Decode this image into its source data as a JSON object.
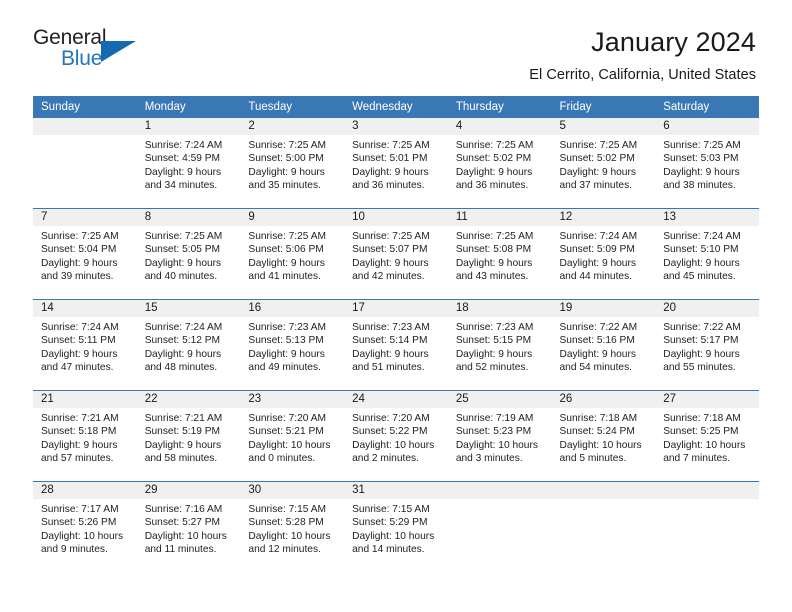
{
  "logo": {
    "text_primary": "General",
    "text_secondary": "Blue",
    "icon": "triangle-logo-mark",
    "color_primary": "#231f20",
    "color_secondary": "#2176bd"
  },
  "header": {
    "title": "January 2024",
    "subtitle": "El Cerrito, California, United States"
  },
  "theme": {
    "header_blue": "#3a77b5",
    "daynum_bg": "#f0f0f0",
    "text": "#1a1a1a"
  },
  "calendar": {
    "weekday_headers": [
      "Sunday",
      "Monday",
      "Tuesday",
      "Wednesday",
      "Thursday",
      "Friday",
      "Saturday"
    ],
    "weeks": [
      [
        {
          "day": "",
          "blank": true,
          "sunrise": "",
          "sunset": "",
          "daylight_1": "",
          "daylight_2": ""
        },
        {
          "day": "1",
          "sunrise": "Sunrise: 7:24 AM",
          "sunset": "Sunset: 4:59 PM",
          "daylight_1": "Daylight: 9 hours",
          "daylight_2": "and 34 minutes."
        },
        {
          "day": "2",
          "sunrise": "Sunrise: 7:25 AM",
          "sunset": "Sunset: 5:00 PM",
          "daylight_1": "Daylight: 9 hours",
          "daylight_2": "and 35 minutes."
        },
        {
          "day": "3",
          "sunrise": "Sunrise: 7:25 AM",
          "sunset": "Sunset: 5:01 PM",
          "daylight_1": "Daylight: 9 hours",
          "daylight_2": "and 36 minutes."
        },
        {
          "day": "4",
          "sunrise": "Sunrise: 7:25 AM",
          "sunset": "Sunset: 5:02 PM",
          "daylight_1": "Daylight: 9 hours",
          "daylight_2": "and 36 minutes."
        },
        {
          "day": "5",
          "sunrise": "Sunrise: 7:25 AM",
          "sunset": "Sunset: 5:02 PM",
          "daylight_1": "Daylight: 9 hours",
          "daylight_2": "and 37 minutes."
        },
        {
          "day": "6",
          "sunrise": "Sunrise: 7:25 AM",
          "sunset": "Sunset: 5:03 PM",
          "daylight_1": "Daylight: 9 hours",
          "daylight_2": "and 38 minutes."
        }
      ],
      [
        {
          "day": "7",
          "sunrise": "Sunrise: 7:25 AM",
          "sunset": "Sunset: 5:04 PM",
          "daylight_1": "Daylight: 9 hours",
          "daylight_2": "and 39 minutes."
        },
        {
          "day": "8",
          "sunrise": "Sunrise: 7:25 AM",
          "sunset": "Sunset: 5:05 PM",
          "daylight_1": "Daylight: 9 hours",
          "daylight_2": "and 40 minutes."
        },
        {
          "day": "9",
          "sunrise": "Sunrise: 7:25 AM",
          "sunset": "Sunset: 5:06 PM",
          "daylight_1": "Daylight: 9 hours",
          "daylight_2": "and 41 minutes."
        },
        {
          "day": "10",
          "sunrise": "Sunrise: 7:25 AM",
          "sunset": "Sunset: 5:07 PM",
          "daylight_1": "Daylight: 9 hours",
          "daylight_2": "and 42 minutes."
        },
        {
          "day": "11",
          "sunrise": "Sunrise: 7:25 AM",
          "sunset": "Sunset: 5:08 PM",
          "daylight_1": "Daylight: 9 hours",
          "daylight_2": "and 43 minutes."
        },
        {
          "day": "12",
          "sunrise": "Sunrise: 7:24 AM",
          "sunset": "Sunset: 5:09 PM",
          "daylight_1": "Daylight: 9 hours",
          "daylight_2": "and 44 minutes."
        },
        {
          "day": "13",
          "sunrise": "Sunrise: 7:24 AM",
          "sunset": "Sunset: 5:10 PM",
          "daylight_1": "Daylight: 9 hours",
          "daylight_2": "and 45 minutes."
        }
      ],
      [
        {
          "day": "14",
          "sunrise": "Sunrise: 7:24 AM",
          "sunset": "Sunset: 5:11 PM",
          "daylight_1": "Daylight: 9 hours",
          "daylight_2": "and 47 minutes."
        },
        {
          "day": "15",
          "sunrise": "Sunrise: 7:24 AM",
          "sunset": "Sunset: 5:12 PM",
          "daylight_1": "Daylight: 9 hours",
          "daylight_2": "and 48 minutes."
        },
        {
          "day": "16",
          "sunrise": "Sunrise: 7:23 AM",
          "sunset": "Sunset: 5:13 PM",
          "daylight_1": "Daylight: 9 hours",
          "daylight_2": "and 49 minutes."
        },
        {
          "day": "17",
          "sunrise": "Sunrise: 7:23 AM",
          "sunset": "Sunset: 5:14 PM",
          "daylight_1": "Daylight: 9 hours",
          "daylight_2": "and 51 minutes."
        },
        {
          "day": "18",
          "sunrise": "Sunrise: 7:23 AM",
          "sunset": "Sunset: 5:15 PM",
          "daylight_1": "Daylight: 9 hours",
          "daylight_2": "and 52 minutes."
        },
        {
          "day": "19",
          "sunrise": "Sunrise: 7:22 AM",
          "sunset": "Sunset: 5:16 PM",
          "daylight_1": "Daylight: 9 hours",
          "daylight_2": "and 54 minutes."
        },
        {
          "day": "20",
          "sunrise": "Sunrise: 7:22 AM",
          "sunset": "Sunset: 5:17 PM",
          "daylight_1": "Daylight: 9 hours",
          "daylight_2": "and 55 minutes."
        }
      ],
      [
        {
          "day": "21",
          "sunrise": "Sunrise: 7:21 AM",
          "sunset": "Sunset: 5:18 PM",
          "daylight_1": "Daylight: 9 hours",
          "daylight_2": "and 57 minutes."
        },
        {
          "day": "22",
          "sunrise": "Sunrise: 7:21 AM",
          "sunset": "Sunset: 5:19 PM",
          "daylight_1": "Daylight: 9 hours",
          "daylight_2": "and 58 minutes."
        },
        {
          "day": "23",
          "sunrise": "Sunrise: 7:20 AM",
          "sunset": "Sunset: 5:21 PM",
          "daylight_1": "Daylight: 10 hours",
          "daylight_2": "and 0 minutes."
        },
        {
          "day": "24",
          "sunrise": "Sunrise: 7:20 AM",
          "sunset": "Sunset: 5:22 PM",
          "daylight_1": "Daylight: 10 hours",
          "daylight_2": "and 2 minutes."
        },
        {
          "day": "25",
          "sunrise": "Sunrise: 7:19 AM",
          "sunset": "Sunset: 5:23 PM",
          "daylight_1": "Daylight: 10 hours",
          "daylight_2": "and 3 minutes."
        },
        {
          "day": "26",
          "sunrise": "Sunrise: 7:18 AM",
          "sunset": "Sunset: 5:24 PM",
          "daylight_1": "Daylight: 10 hours",
          "daylight_2": "and 5 minutes."
        },
        {
          "day": "27",
          "sunrise": "Sunrise: 7:18 AM",
          "sunset": "Sunset: 5:25 PM",
          "daylight_1": "Daylight: 10 hours",
          "daylight_2": "and 7 minutes."
        }
      ],
      [
        {
          "day": "28",
          "sunrise": "Sunrise: 7:17 AM",
          "sunset": "Sunset: 5:26 PM",
          "daylight_1": "Daylight: 10 hours",
          "daylight_2": "and 9 minutes."
        },
        {
          "day": "29",
          "sunrise": "Sunrise: 7:16 AM",
          "sunset": "Sunset: 5:27 PM",
          "daylight_1": "Daylight: 10 hours",
          "daylight_2": "and 11 minutes."
        },
        {
          "day": "30",
          "sunrise": "Sunrise: 7:15 AM",
          "sunset": "Sunset: 5:28 PM",
          "daylight_1": "Daylight: 10 hours",
          "daylight_2": "and 12 minutes."
        },
        {
          "day": "31",
          "sunrise": "Sunrise: 7:15 AM",
          "sunset": "Sunset: 5:29 PM",
          "daylight_1": "Daylight: 10 hours",
          "daylight_2": "and 14 minutes."
        },
        {
          "day": "",
          "blank": true,
          "sunrise": "",
          "sunset": "",
          "daylight_1": "",
          "daylight_2": ""
        },
        {
          "day": "",
          "blank": true,
          "sunrise": "",
          "sunset": "",
          "daylight_1": "",
          "daylight_2": ""
        },
        {
          "day": "",
          "blank": true,
          "sunrise": "",
          "sunset": "",
          "daylight_1": "",
          "daylight_2": ""
        }
      ]
    ]
  }
}
